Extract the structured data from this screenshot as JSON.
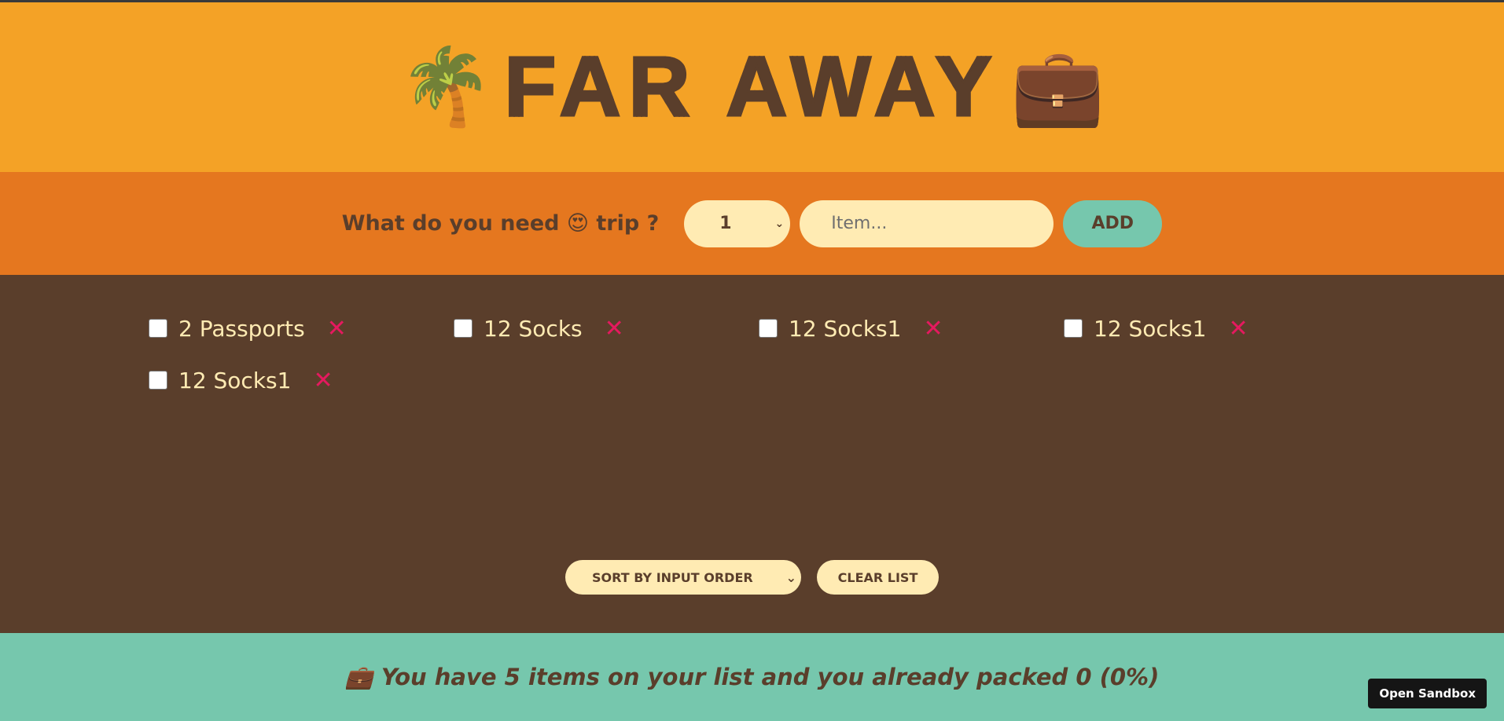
{
  "header": {
    "title": "FAR AWAY",
    "left_emoji": "🌴",
    "right_emoji": "💼"
  },
  "form": {
    "question": "What do you need 😍 trip ?",
    "quantity": "1",
    "item_placeholder": "Item...",
    "add_label": "ADD"
  },
  "items": [
    {
      "label": "2 Passports",
      "packed": false
    },
    {
      "label": "12 Socks",
      "packed": false
    },
    {
      "label": "12 Socks1",
      "packed": false
    },
    {
      "label": "12 Socks1",
      "packed": false
    },
    {
      "label": "12 Socks1",
      "packed": false
    }
  ],
  "delete_glyph": "✕",
  "actions": {
    "sort_value": "SORT BY INPUT ORDER",
    "clear_label": "CLEAR LIST"
  },
  "footer": {
    "stats": "💼 You have 5 items on your list and you already packed 0 (0%)"
  },
  "sandbox_label": "Open Sandbox"
}
